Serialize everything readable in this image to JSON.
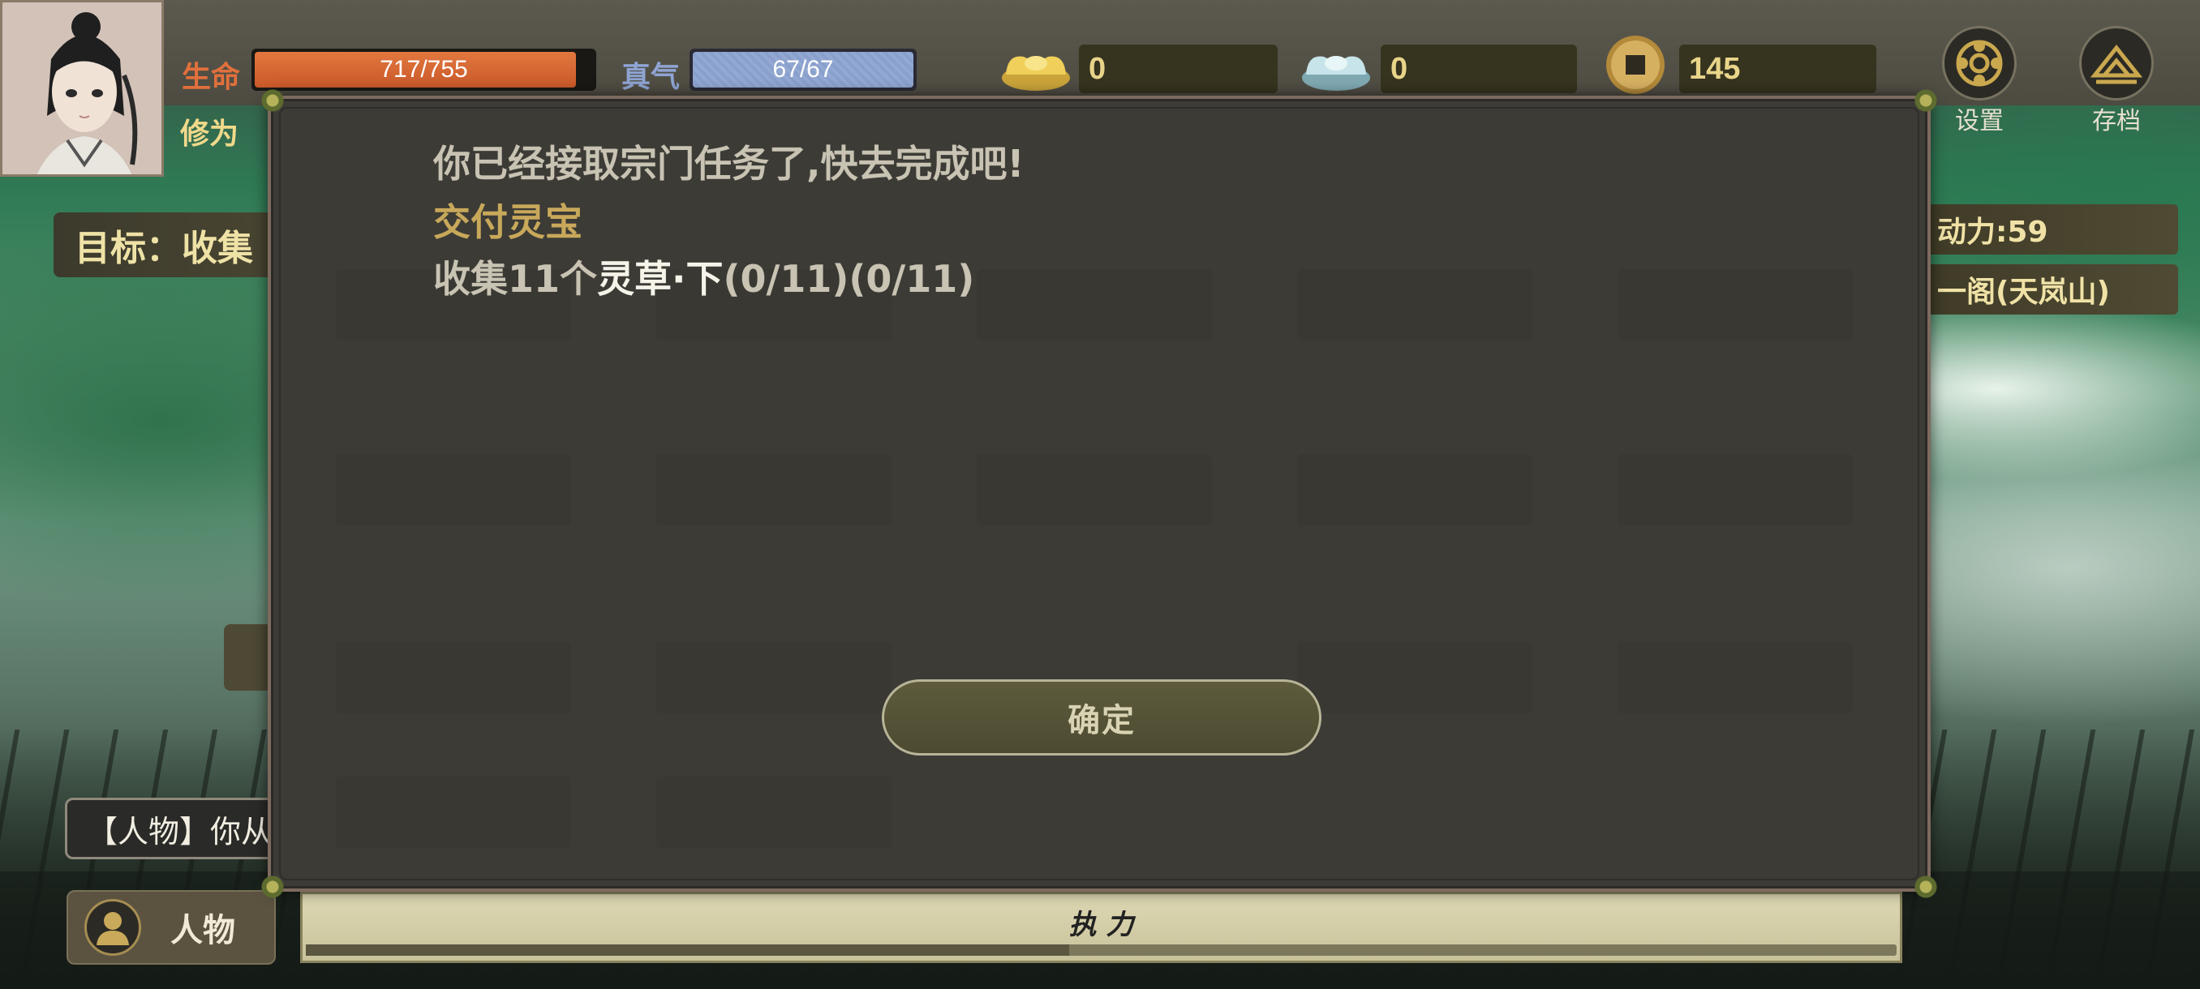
{
  "status": {
    "hp_label": "生命",
    "hp_text": "717/755",
    "hp_fraction": 0.95,
    "qi_label": "真气",
    "qi_text": "67/67",
    "qi_fraction": 1.0,
    "cultivation_label": "修为"
  },
  "currency": {
    "gold_ingot": "0",
    "silver_ingot": "0",
    "coins": "145"
  },
  "top_buttons": {
    "settings_label": "设置",
    "save_label": "存档"
  },
  "background": {
    "goal_label": "目标：收集",
    "stamina_tag": "动力:59",
    "location_tag": "一阁(天岚山)",
    "log_text": "【人物】你从"
  },
  "dialog": {
    "line1": "你已经接取宗门任务了,快去完成吧!",
    "line2": "交付灵宝",
    "line3_prefix": "收集11个",
    "line3_item": "灵草·下",
    "line3_suffix": "(0/11)(0/11)",
    "confirm_label": "确定"
  },
  "bottom": {
    "character_label": "人物",
    "stamina_label": "执 力",
    "stamina_fraction": 0.48
  },
  "colors": {
    "hp": "#d9683a",
    "qi": "#93a8d2",
    "accent_gold": "#c8a85a"
  }
}
